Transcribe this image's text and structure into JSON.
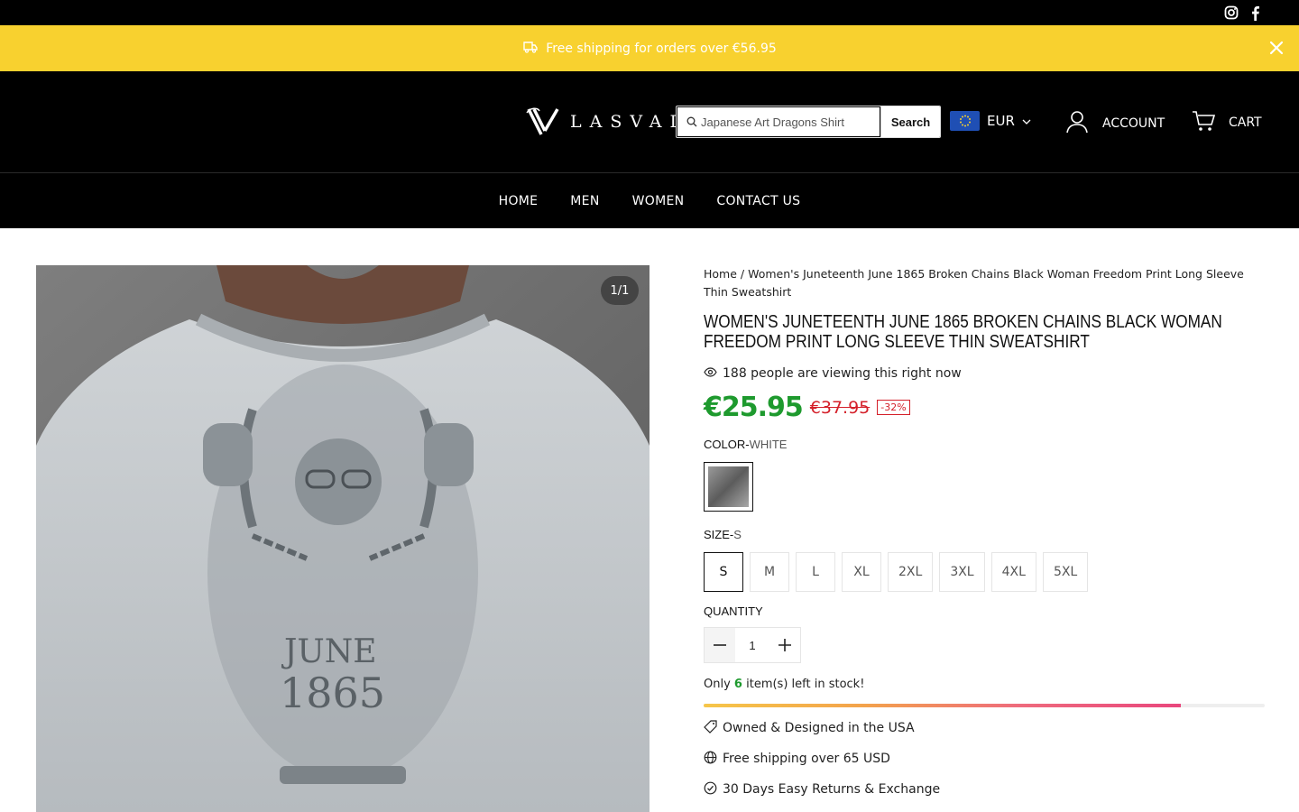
{
  "social": {
    "instagram_icon": "instagram-icon",
    "facebook_icon": "facebook-icon"
  },
  "promo": {
    "text": "Free shipping for orders over €56.95"
  },
  "header": {
    "logo_text": "LASVAD",
    "search": {
      "placeholder": "Japanese Art Dragons Shirt",
      "button_label": "Search"
    },
    "currency": "EUR",
    "account_label": "ACCOUNT",
    "cart_label": "CART"
  },
  "nav": {
    "items": [
      "HOME",
      "MEN",
      "WOMEN",
      "CONTACT US"
    ]
  },
  "gallery": {
    "counter": "1/1"
  },
  "product": {
    "breadcrumb_home": "Home",
    "breadcrumb_sep": "/",
    "breadcrumb_current": "Women's Juneteenth June 1865 Broken Chains Black Woman Freedom Print Long Sleeve Thin Sweatshirt",
    "title": "WOMEN'S JUNETEENTH JUNE 1865 BROKEN CHAINS BLACK WOMAN FREEDOM PRINT LONG SLEEVE THIN SWEATSHIRT",
    "viewers_text": "188 people are viewing this right now",
    "price_now": "€25.95",
    "price_old": "€37.95",
    "discount": "-32%",
    "color_label": "COLOR-",
    "color_value": "WHITE",
    "size_label": "SIZE-",
    "size_value": "S",
    "sizes": [
      "S",
      "M",
      "L",
      "XL",
      "2XL",
      "3XL",
      "4XL",
      "5XL"
    ],
    "quantity_label": "QUANTITY",
    "quantity": "1",
    "stock_prefix": "Only",
    "stock_count": "6",
    "stock_suffix": "item(s) left in stock!",
    "stock_fill_fraction": 0.85,
    "features": [
      "Owned & Designed in the USA",
      "Free shipping over 65 USD",
      "30 Days Easy Returns & Exchange"
    ]
  },
  "colors": {
    "promo_bg": "#f8d12f",
    "price_green": "#1e9a2e",
    "price_red": "#d4202a"
  }
}
